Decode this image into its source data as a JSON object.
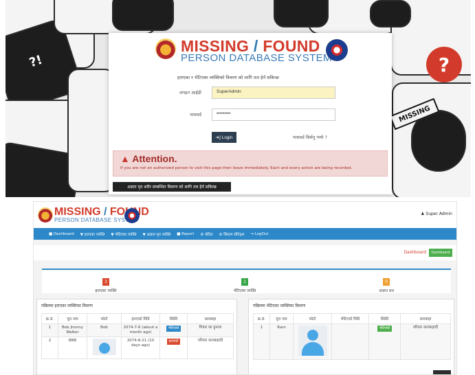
{
  "login": {
    "brand_missing": "MISSING",
    "brand_slash": " / ",
    "brand_found": "FOUND",
    "brand_sub": "PERSON DATABASE SYSTEM",
    "note": "हराएका र भेटिएका व्यक्तिको विवरण को लागि तल हेर्न सकिन्छ",
    "login_id_label": "लगइन आईडी",
    "login_id_value": "SuperAdmin",
    "password_label": "पासवर्ड",
    "password_value": "•••••••••",
    "login_button": "➜] Login",
    "forgot_link": "पासवर्ड बिर्सनु भयो ?",
    "alert_icon": "▲",
    "alert_title": "Attention.",
    "alert_text": "If you are not an authorized person to visit this page then leave immediately. Each and every action are being recorded.",
    "bodies_button": "अज्ञात मृत शरीर सम्बन्धित विवरण को लागि तल हेर्न सकिन्छ",
    "bg_signs": {
      "left": "?!",
      "right": "?",
      "tag": "MISSING"
    }
  },
  "dashboard": {
    "brand_missing": "MISSING",
    "brand_slash": " / ",
    "brand_found": "FOUND",
    "brand_sub": "PERSON DATABASE SYSTEM",
    "user": "♟ Super Admin",
    "nav": [
      "■ Dashboard",
      "▼ हराएका व्यक्ति",
      "▼ भेटिएका व्यक्ति",
      "▼ अज्ञात मृत व्यक्ति",
      "■ Report",
      "⚙ सेटिङ",
      "⚙ सिस्टम सेटिङ्स",
      "↪ LogOut"
    ],
    "breadcrumb": "Dashboard",
    "breadcrumb_button": "Dashboard",
    "stats": [
      {
        "value": "3",
        "label": "हराएका व्यक्ति",
        "color": "#d9492e"
      },
      {
        "value": "1",
        "label": "भेटिएका व्यक्ति",
        "color": "#3aa64a"
      },
      {
        "value": "0",
        "label": "अज्ञात शव",
        "color": "#f0a030"
      }
    ],
    "missing_panel": {
      "title": "पछिल्ला हराएका व्यक्तिका विवरण",
      "headers": [
        "क्र.सं.",
        "पूरा नाम",
        "फोटो",
        "हराएको मिति",
        "स्थिति",
        "कारबाहा"
      ],
      "rows": [
        {
          "sn": "1",
          "name": "Bob jhonny Walker",
          "photo": "Bob",
          "date": "2074-7-6 (about a month ago)",
          "status": "भेटिएको",
          "status_color": "#2c88c8",
          "action": "विचार का हुनाया"
        },
        {
          "sn": "2",
          "name": "BBB",
          "photo": "",
          "date": "2074-8-21 (10 days ago)",
          "status": "हराएको",
          "status_color": "#d9492e",
          "action": "परिवार कारबाहादी"
        }
      ]
    },
    "found_panel": {
      "title": "पछिल्ला भेटिएका व्यक्तिका विवरण",
      "headers": [
        "क्र.सं.",
        "पूरा नाम",
        "फोटो",
        "भेटिएको मिति",
        "स्थिति",
        "कारबाहा"
      ],
      "rows": [
        {
          "sn": "1",
          "name": "Ram",
          "photo": "",
          "date": "",
          "status": "भेटिएको",
          "status_color": "#4cae4c",
          "action": "परिवार कारबाहादी"
        }
      ]
    }
  }
}
